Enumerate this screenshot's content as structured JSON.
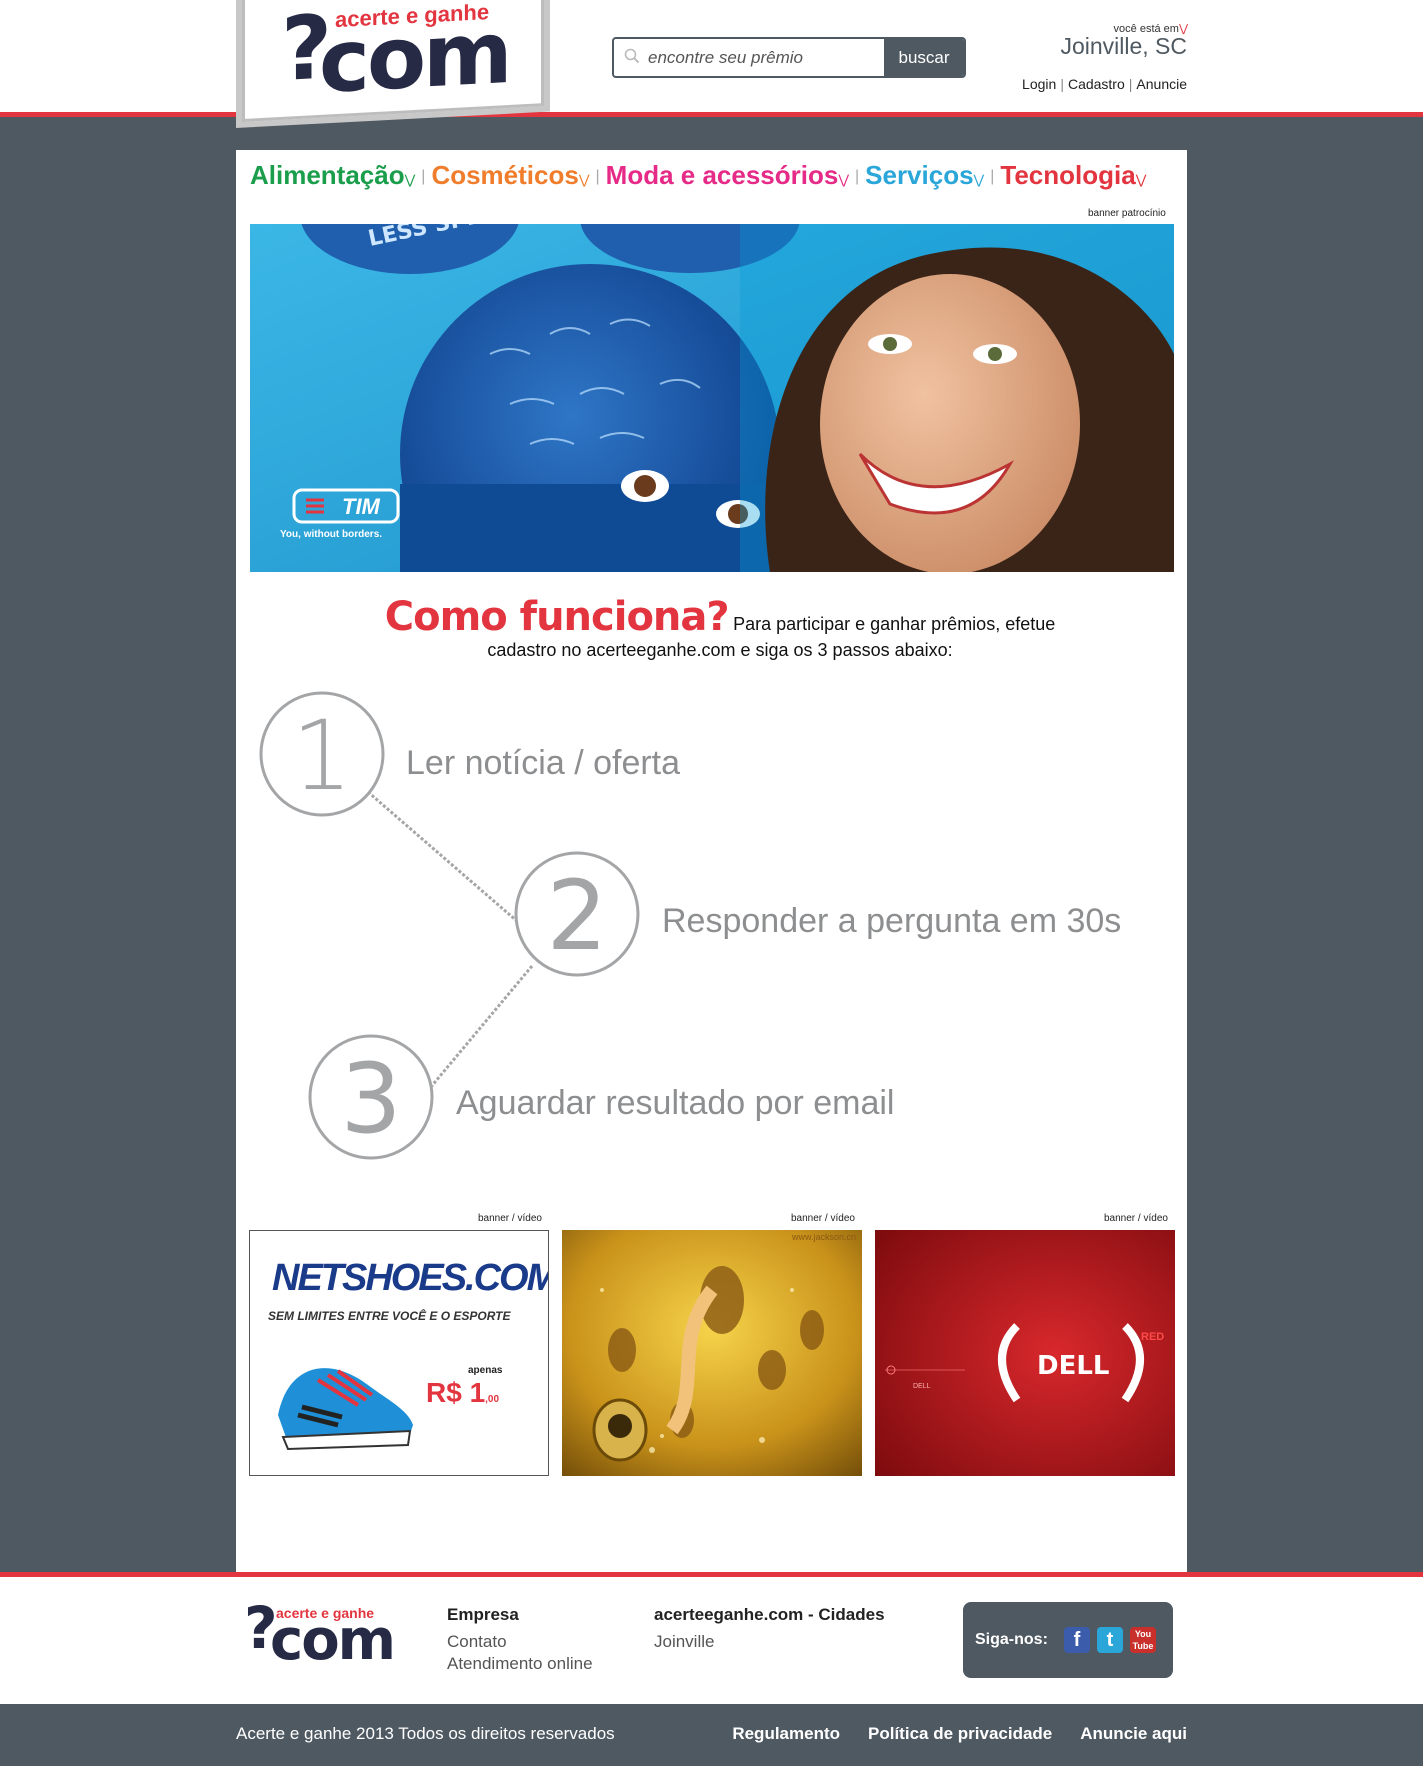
{
  "header": {
    "logo": {
      "tagline": "acerte e ganhe",
      "mark": "?",
      "word": "com"
    },
    "search": {
      "placeholder": "encontre seu prêmio",
      "button": "buscar"
    },
    "location": {
      "label": "você está em",
      "city": "Joinville, SC"
    },
    "auth": {
      "login": "Login",
      "signup": "Cadastro",
      "advertise": "Anuncie"
    }
  },
  "categories": [
    {
      "label": "Alimentação",
      "color": "#1a9e4b"
    },
    {
      "label": "Cosméticos",
      "color": "#f07d2c"
    },
    {
      "label": "Moda e acessórios",
      "color": "#e62a87"
    },
    {
      "label": "Serviços",
      "color": "#2aa6d9"
    },
    {
      "label": "Tecnologia",
      "color": "#e3353f"
    }
  ],
  "banner_main": {
    "label": "banner patrocínio",
    "brand": "TIM",
    "slogan": "You, without borders.",
    "text_on_ball": "LESS SPEN"
  },
  "how": {
    "title": "Como funciona?",
    "text": "Para participar e ganhar prêmios, efetue cadastro no acerteeganhe.com e siga os 3 passos abaixo:"
  },
  "steps": [
    {
      "number": "1",
      "text": "Ler notícia / oferta"
    },
    {
      "number": "2",
      "text": "Responder a pergunta em 30s"
    },
    {
      "number": "3",
      "text": "Aguardar resultado por email"
    }
  ],
  "thumbs": [
    {
      "label": "banner / vídeo",
      "brand": "NETSHOES.COM.BR",
      "subtitle": "SEM LIMITES ENTRE VOCÊ E O ESPORTE",
      "price_prefix": "apenas",
      "price": "R$ 1",
      "price_cents": ",00"
    },
    {
      "label": "banner / vídeo",
      "url": "www.jackson.cn"
    },
    {
      "label": "banner / vídeo",
      "brand": "DELL",
      "tag": "RED",
      "small": "DELL"
    }
  ],
  "footer": {
    "logo": {
      "tagline": "acerte e ganhe",
      "mark": "?",
      "word": "com"
    },
    "company": {
      "title": "Empresa",
      "links": [
        "Contato",
        "Atendimento online"
      ]
    },
    "cities": {
      "title": "acerteeganhe.com - Cidades",
      "links": [
        "Joinville"
      ]
    },
    "social": {
      "label": "Siga-nos:",
      "fb": "f",
      "tw": "t",
      "yt_top": "You",
      "yt_bottom": "Tube"
    }
  },
  "bottom": {
    "copyright": "Acerte e ganhe 2013 Todos os direitos reservados",
    "links": [
      "Regulamento",
      "Política de privacidade",
      "Anuncie aqui"
    ]
  },
  "colors": {
    "brand_dark": "#262a45",
    "accent": "#e3353f",
    "bar": "#4f5961"
  }
}
